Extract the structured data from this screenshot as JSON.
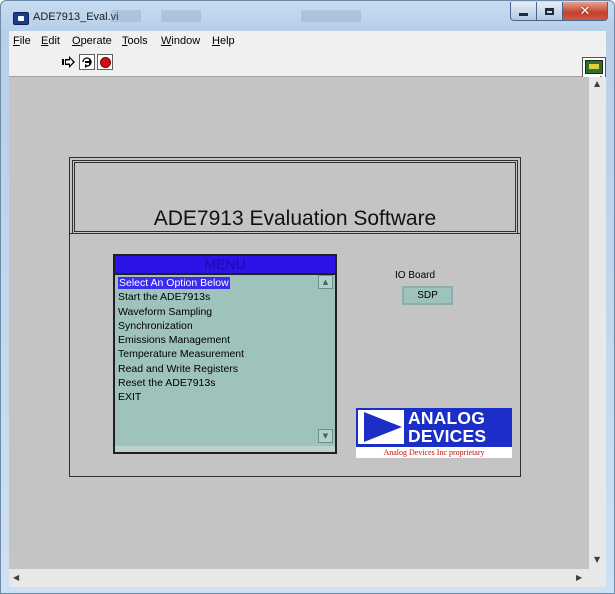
{
  "window": {
    "title": "ADE7913_Eval.vi",
    "close_glyph": "✕"
  },
  "menubar": {
    "items": [
      {
        "label": "File",
        "underline": "F",
        "rest": "ile"
      },
      {
        "label": "Edit",
        "underline": "E",
        "rest": "dit"
      },
      {
        "label": "Operate",
        "underline": "O",
        "rest": "perate"
      },
      {
        "label": "Tools",
        "underline": "T",
        "rest": "ools"
      },
      {
        "label": "Window",
        "underline": "W",
        "rest": "indow"
      },
      {
        "label": "Help",
        "underline": "H",
        "rest": "elp"
      }
    ]
  },
  "toolbar": {
    "buttons": [
      "run-arrow-icon",
      "run-continuously-icon",
      "abort-icon"
    ]
  },
  "panel": {
    "app_title": "ADE7913 Evaluation Software",
    "menu": {
      "header": "MENU",
      "selected_index": 0,
      "options": [
        "Select An Option Below",
        "Start the ADE7913s",
        "Waveform Sampling",
        "Synchronization",
        "Emissions Management",
        "Temperature Measurement",
        "Read and Write Registers",
        "Reset the ADE7913s",
        "EXIT"
      ]
    },
    "io_board": {
      "label": "IO Board",
      "value": "SDP"
    },
    "logo": {
      "line1": "ANALOG",
      "line2": "DEVICES",
      "tagline": "Analog Devices Inc proprietary"
    }
  },
  "colors": {
    "panel_bg": "#c4c4c4",
    "listbox_bg": "#9ec2bc",
    "menu_header_bg": "#2d14e6",
    "selection_bg": "#3b2cf0",
    "logo_blue": "#1b2fc8",
    "logo_tagline_red": "#c01010"
  }
}
